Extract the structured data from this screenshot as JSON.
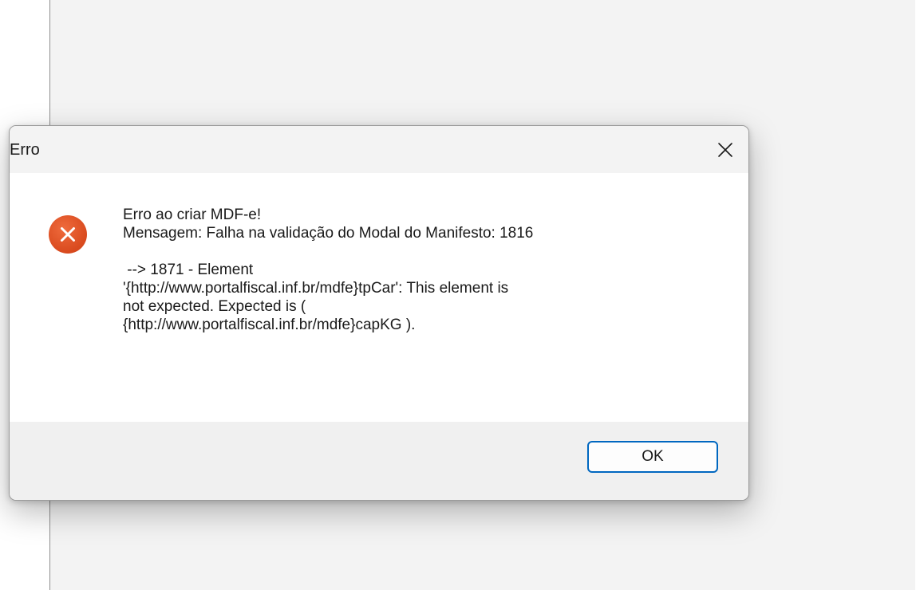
{
  "dialog": {
    "title": "Erro",
    "icon": "error-icon",
    "message_heading": "Erro ao criar MDF-e!",
    "message_line": "Mensagem: Falha na validação do Modal do Manifesto: 1816",
    "message_detail": " --> 1871 - Element\n'{http://www.portalfiscal.inf.br/mdfe}tpCar': This element is\nnot expected. Expected is (\n{http://www.portalfiscal.inf.br/mdfe}capKG ).",
    "ok_label": "OK",
    "close_icon": "close-icon"
  },
  "colors": {
    "accent": "#0067c0",
    "error": "#d94a1e"
  }
}
